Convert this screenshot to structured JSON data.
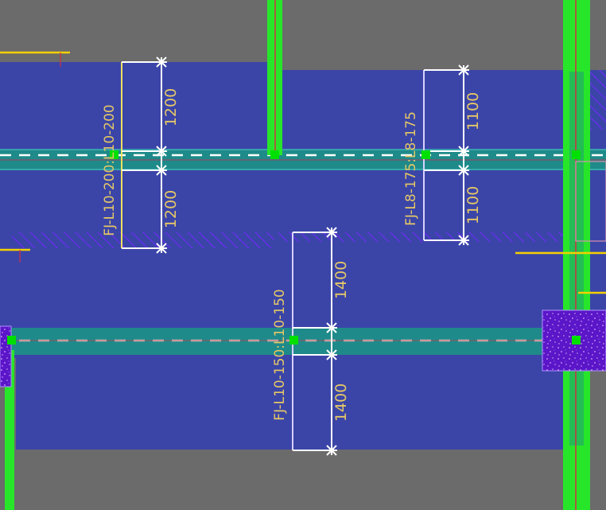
{
  "drawing": {
    "colors": {
      "background": "#6b6b6b",
      "slab": "#3b45a8",
      "beam": "#1f8a8a",
      "column": "#27e62a",
      "node": "#00e000",
      "dimension": "#ffffff",
      "label": "#e6c866",
      "hatch": "#6a2cf0",
      "yellow_line": "#f4d000",
      "red_line": "#d03040",
      "pink_line": "#d890b0"
    },
    "dimensions": {
      "d1": "1200",
      "d2": "1200",
      "d3": "1100",
      "d4": "1100",
      "d5": "1400",
      "d6": "1400"
    },
    "labels": {
      "l1": "FJ-L10-200:L10-200",
      "l2": "FJ-L8-175:L8-175",
      "l3": "FJ-L10-150:L10-150"
    }
  }
}
